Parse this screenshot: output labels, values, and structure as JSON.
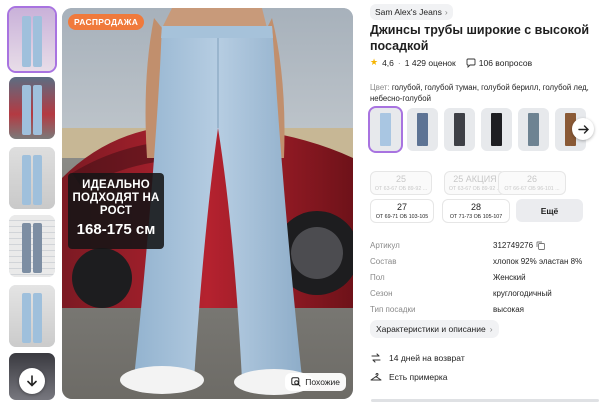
{
  "gallery": {
    "sale_badge": "РАСПРОДАЖА",
    "fit_lines": [
      "ИДЕАЛЬНО",
      "ПОДХОДЯТ НА",
      "РОСТ"
    ],
    "fit_size": "168-175 см",
    "similar_label": "Похожие",
    "thumbnail_count": 6
  },
  "product": {
    "brand": "Sam Alex's Jeans",
    "title": "Джинсы трубы широкие с высокой посадкой",
    "rating": "4,6",
    "reviews": "1 429 оценок",
    "questions": "106 вопросов",
    "color_label": "Цвет:",
    "color_value": "голубой, голубой туман, голубой берилл, голубой лед, небесно-голубой"
  },
  "swatches": [
    {
      "color": "#a9c6e2",
      "active": true
    },
    {
      "color": "#5d7394",
      "active": false
    },
    {
      "color": "#3e4046",
      "active": false
    },
    {
      "color": "#1e1e22",
      "active": false
    },
    {
      "color": "#6e8392",
      "active": false
    },
    {
      "color": "#8a5a36",
      "active": false
    }
  ],
  "sizes": [
    {
      "num": "25",
      "meas": "ОТ 63-67 ОБ 89-92 ...",
      "available": false
    },
    {
      "num": "25 АКЦИЯ",
      "meas": "ОТ 63-67 ОБ 89-92 ...",
      "available": false
    },
    {
      "num": "26",
      "meas": "ОТ 66-67 ОБ 96-101 ...",
      "available": false
    },
    {
      "num": "27",
      "meas": "ОТ 69-71 ОБ 103-105",
      "available": true
    },
    {
      "num": "28",
      "meas": "ОТ 71-73 ОБ 105-107",
      "available": true
    }
  ],
  "more_sizes": "Ещё",
  "specs": [
    {
      "key": "Артикул",
      "value": "312749276"
    },
    {
      "key": "Состав",
      "value": "хлопок 92% эластан 8%"
    },
    {
      "key": "Пол",
      "value": "Женский"
    },
    {
      "key": "Сезон",
      "value": "круглогодичный"
    },
    {
      "key": "Тип посадки",
      "value": "высокая"
    }
  ],
  "details_button": "Характеристики и описание",
  "perks": {
    "returns": "14 дней на возврат",
    "try_on": "Есть примерка"
  },
  "colors": {
    "accent": "#a873e0",
    "sale": "#f07a3c",
    "star": "#f5b400"
  }
}
